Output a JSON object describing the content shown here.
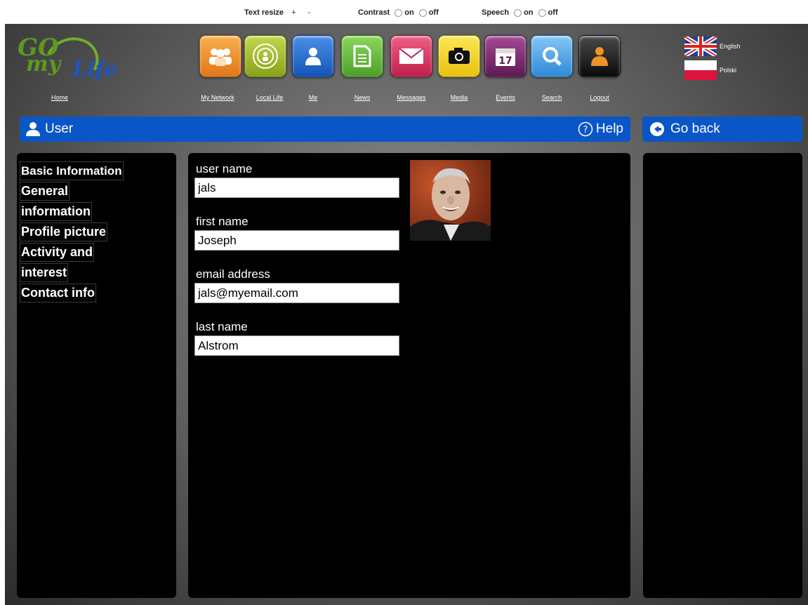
{
  "accessibility": {
    "text_resize_label": "Text resize",
    "text_resize_plus": "+",
    "text_resize_minus": "-",
    "contrast_label": "Contrast",
    "contrast_on": "on",
    "contrast_off": "off",
    "speech_label": "Speech",
    "speech_on": "on",
    "speech_off": "off"
  },
  "header": {
    "logo_go": "GO",
    "logo_my": "my",
    "logo_life": "Life",
    "home_label": "Home",
    "nav": [
      {
        "label": "My Network",
        "icon": "people-icon",
        "color": "#f08c22"
      },
      {
        "label": "Local Life",
        "icon": "target-icon",
        "color": "#9cbb22"
      },
      {
        "label": "Me",
        "icon": "person-icon",
        "color": "#1d68d1"
      },
      {
        "label": "News",
        "icon": "document-icon",
        "color": "#6cc13b"
      },
      {
        "label": "Messages",
        "icon": "envelope-icon",
        "color": "#d8325f"
      },
      {
        "label": "Media",
        "icon": "camera-icon",
        "color": "#f0d21e"
      },
      {
        "label": "Events",
        "icon": "calendar-icon",
        "color": "#7b2a6d"
      },
      {
        "label": "Search",
        "icon": "magnifier-icon",
        "color": "#4aa4e8"
      },
      {
        "label": "Logout",
        "icon": "logout-icon",
        "color": "#222222"
      }
    ],
    "languages": [
      {
        "label": "English",
        "icon": "uk-flag-icon"
      },
      {
        "label": "Polski",
        "icon": "poland-flag-icon"
      }
    ]
  },
  "titlebar": {
    "title": "User",
    "help_label": "Help",
    "go_back_label": "Go back"
  },
  "sidebar": {
    "items": [
      "Basic Information",
      "General",
      "information",
      "Profile picture",
      "Activity and",
      "interest",
      "Contact info"
    ]
  },
  "form": {
    "user_name_label": "user name",
    "user_name_value": "jals",
    "first_name_label": "first name",
    "first_name_value": "Joseph",
    "email_label": "email address",
    "email_value": "jals@myemail.com",
    "last_name_label": "last name",
    "last_name_value": "Alstrom"
  },
  "colors": {
    "accent_blue": "#0b56c6",
    "panel_bg": "#000000",
    "logo_green": "#5c9a1f"
  }
}
